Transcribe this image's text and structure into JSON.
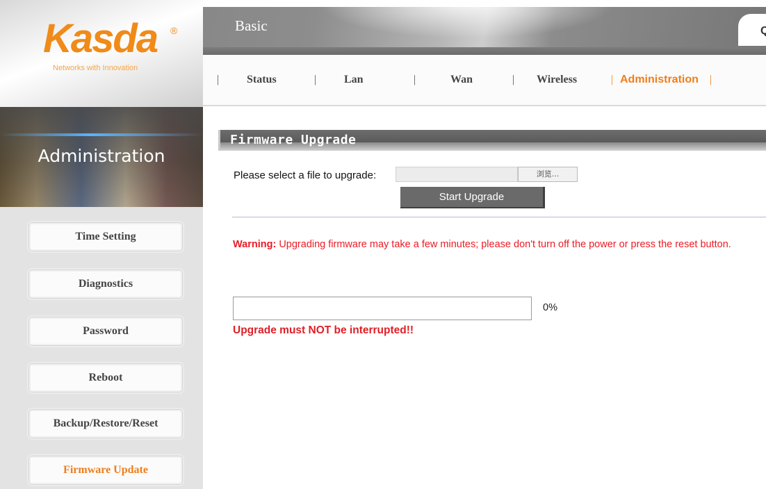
{
  "brand": {
    "name": "Kasda",
    "registered_mark": "®",
    "tagline": "Networks with Innovation"
  },
  "section_banner": {
    "title": "Administration"
  },
  "header": {
    "active_tab": "Basic",
    "right_tab_partial": "Q"
  },
  "nav": {
    "items": [
      {
        "label": "Status"
      },
      {
        "label": "Lan"
      },
      {
        "label": "Wan"
      },
      {
        "label": "Wireless"
      },
      {
        "label": "Administration"
      }
    ],
    "active": "Administration",
    "separator": "|"
  },
  "sidebar": {
    "items": [
      {
        "label": "Time Setting"
      },
      {
        "label": "Diagnostics"
      },
      {
        "label": "Password"
      },
      {
        "label": "Reboot"
      },
      {
        "label": "Backup/Restore/Reset"
      },
      {
        "label": "Firmware Update"
      }
    ],
    "active": "Firmware Update"
  },
  "main": {
    "section_title": "Firmware Upgrade",
    "upload_label": "Please select a file to upgrade:",
    "file_input_value": "",
    "browse_label": "浏览...",
    "start_button": "Start Upgrade",
    "warning_prefix": "Warning:",
    "warning_body": " Upgrading firmware may take a few minutes; please don't turn off the power or press the reset button.",
    "progress_percent_text": "0%",
    "progress_value": 0,
    "interrupt_note": "Upgrade must NOT be interrupted!!"
  },
  "colors": {
    "accent_orange": "#f07d1a",
    "warning_red": "#ea1b24",
    "header_gray": "#8b8b8b",
    "button_gray": "#6a6a6a"
  }
}
